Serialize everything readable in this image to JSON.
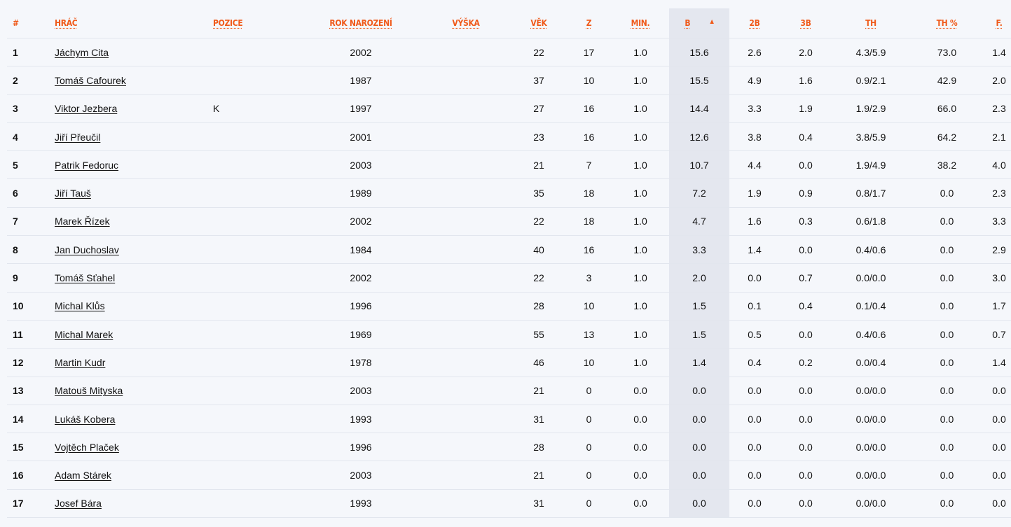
{
  "columns": {
    "rank": "#",
    "player": "HRÁČ",
    "position": "POZICE",
    "birth_year": "ROK NAROZENÍ",
    "height": "VÝŠKA",
    "age": "VĚK",
    "games": "Z",
    "minutes": "MIN.",
    "points": "B",
    "two_pt": "2B",
    "three_pt": "3B",
    "free_throws": "TH",
    "ft_pct": "TH %",
    "fouls": "F."
  },
  "sort": {
    "column": "points",
    "direction": "desc",
    "arrow": "▲"
  },
  "accent_color": "#f05a1a",
  "rows": [
    {
      "rank": "1",
      "name": "Jáchym Cita",
      "position": "",
      "birth_year": "2002",
      "height": "",
      "age": "22",
      "games": "17",
      "minutes": "1.0",
      "points": "15.6",
      "two_pt": "2.6",
      "three_pt": "2.0",
      "free_throws": "4.3/5.9",
      "ft_pct": "73.0",
      "fouls": "1.4"
    },
    {
      "rank": "2",
      "name": "Tomáš Cafourek",
      "position": "",
      "birth_year": "1987",
      "height": "",
      "age": "37",
      "games": "10",
      "minutes": "1.0",
      "points": "15.5",
      "two_pt": "4.9",
      "three_pt": "1.6",
      "free_throws": "0.9/2.1",
      "ft_pct": "42.9",
      "fouls": "2.0"
    },
    {
      "rank": "3",
      "name": "Viktor Jezbera",
      "position": "K",
      "birth_year": "1997",
      "height": "",
      "age": "27",
      "games": "16",
      "minutes": "1.0",
      "points": "14.4",
      "two_pt": "3.3",
      "three_pt": "1.9",
      "free_throws": "1.9/2.9",
      "ft_pct": "66.0",
      "fouls": "2.3"
    },
    {
      "rank": "4",
      "name": "Jiří Přeučil",
      "position": "",
      "birth_year": "2001",
      "height": "",
      "age": "23",
      "games": "16",
      "minutes": "1.0",
      "points": "12.6",
      "two_pt": "3.8",
      "three_pt": "0.4",
      "free_throws": "3.8/5.9",
      "ft_pct": "64.2",
      "fouls": "2.1"
    },
    {
      "rank": "5",
      "name": "Patrik Fedoruc",
      "position": "",
      "birth_year": "2003",
      "height": "",
      "age": "21",
      "games": "7",
      "minutes": "1.0",
      "points": "10.7",
      "two_pt": "4.4",
      "three_pt": "0.0",
      "free_throws": "1.9/4.9",
      "ft_pct": "38.2",
      "fouls": "4.0"
    },
    {
      "rank": "6",
      "name": "Jiří Tauš",
      "position": "",
      "birth_year": "1989",
      "height": "",
      "age": "35",
      "games": "18",
      "minutes": "1.0",
      "points": "7.2",
      "two_pt": "1.9",
      "three_pt": "0.9",
      "free_throws": "0.8/1.7",
      "ft_pct": "0.0",
      "fouls": "2.3"
    },
    {
      "rank": "7",
      "name": "Marek Řízek",
      "position": "",
      "birth_year": "2002",
      "height": "",
      "age": "22",
      "games": "18",
      "minutes": "1.0",
      "points": "4.7",
      "two_pt": "1.6",
      "three_pt": "0.3",
      "free_throws": "0.6/1.8",
      "ft_pct": "0.0",
      "fouls": "3.3"
    },
    {
      "rank": "8",
      "name": "Jan Duchoslav",
      "position": "",
      "birth_year": "1984",
      "height": "",
      "age": "40",
      "games": "16",
      "minutes": "1.0",
      "points": "3.3",
      "two_pt": "1.4",
      "three_pt": "0.0",
      "free_throws": "0.4/0.6",
      "ft_pct": "0.0",
      "fouls": "2.9"
    },
    {
      "rank": "9",
      "name": "Tomáš Sťahel",
      "position": "",
      "birth_year": "2002",
      "height": "",
      "age": "22",
      "games": "3",
      "minutes": "1.0",
      "points": "2.0",
      "two_pt": "0.0",
      "three_pt": "0.7",
      "free_throws": "0.0/0.0",
      "ft_pct": "0.0",
      "fouls": "3.0"
    },
    {
      "rank": "10",
      "name": "Michal Klůs",
      "position": "",
      "birth_year": "1996",
      "height": "",
      "age": "28",
      "games": "10",
      "minutes": "1.0",
      "points": "1.5",
      "two_pt": "0.1",
      "three_pt": "0.4",
      "free_throws": "0.1/0.4",
      "ft_pct": "0.0",
      "fouls": "1.7"
    },
    {
      "rank": "11",
      "name": "Michal Marek",
      "position": "",
      "birth_year": "1969",
      "height": "",
      "age": "55",
      "games": "13",
      "minutes": "1.0",
      "points": "1.5",
      "two_pt": "0.5",
      "three_pt": "0.0",
      "free_throws": "0.4/0.6",
      "ft_pct": "0.0",
      "fouls": "0.7"
    },
    {
      "rank": "12",
      "name": "Martin Kudr",
      "position": "",
      "birth_year": "1978",
      "height": "",
      "age": "46",
      "games": "10",
      "minutes": "1.0",
      "points": "1.4",
      "two_pt": "0.4",
      "three_pt": "0.2",
      "free_throws": "0.0/0.4",
      "ft_pct": "0.0",
      "fouls": "1.4"
    },
    {
      "rank": "13",
      "name": "Matouš Mityska",
      "position": "",
      "birth_year": "2003",
      "height": "",
      "age": "21",
      "games": "0",
      "minutes": "0.0",
      "points": "0.0",
      "two_pt": "0.0",
      "three_pt": "0.0",
      "free_throws": "0.0/0.0",
      "ft_pct": "0.0",
      "fouls": "0.0"
    },
    {
      "rank": "14",
      "name": "Lukáš Kobera",
      "position": "",
      "birth_year": "1993",
      "height": "",
      "age": "31",
      "games": "0",
      "minutes": "0.0",
      "points": "0.0",
      "two_pt": "0.0",
      "three_pt": "0.0",
      "free_throws": "0.0/0.0",
      "ft_pct": "0.0",
      "fouls": "0.0"
    },
    {
      "rank": "15",
      "name": "Vojtěch Plaček",
      "position": "",
      "birth_year": "1996",
      "height": "",
      "age": "28",
      "games": "0",
      "minutes": "0.0",
      "points": "0.0",
      "two_pt": "0.0",
      "three_pt": "0.0",
      "free_throws": "0.0/0.0",
      "ft_pct": "0.0",
      "fouls": "0.0"
    },
    {
      "rank": "16",
      "name": "Adam Stárek",
      "position": "",
      "birth_year": "2003",
      "height": "",
      "age": "21",
      "games": "0",
      "minutes": "0.0",
      "points": "0.0",
      "two_pt": "0.0",
      "three_pt": "0.0",
      "free_throws": "0.0/0.0",
      "ft_pct": "0.0",
      "fouls": "0.0"
    },
    {
      "rank": "17",
      "name": "Josef Bára",
      "position": "",
      "birth_year": "1993",
      "height": "",
      "age": "31",
      "games": "0",
      "minutes": "0.0",
      "points": "0.0",
      "two_pt": "0.0",
      "three_pt": "0.0",
      "free_throws": "0.0/0.0",
      "ft_pct": "0.0",
      "fouls": "0.0"
    }
  ]
}
